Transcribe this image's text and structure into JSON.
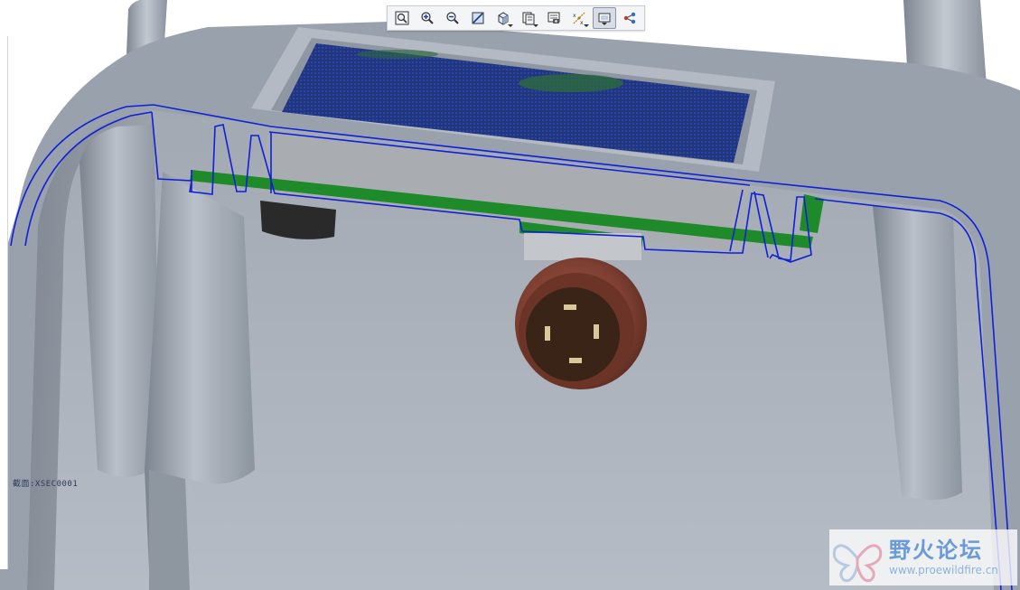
{
  "toolbar": {
    "buttons": [
      {
        "id": "refit",
        "icon": "zoom-fit-icon",
        "tooltip": "Refit"
      },
      {
        "id": "zoom-in",
        "icon": "zoom-in-icon",
        "tooltip": "Zoom In"
      },
      {
        "id": "zoom-out",
        "icon": "zoom-out-icon",
        "tooltip": "Zoom Out"
      },
      {
        "id": "repaint",
        "icon": "repaint-icon",
        "tooltip": "Repaint"
      },
      {
        "id": "display-style",
        "icon": "shaded-cube-icon",
        "tooltip": "Display Style"
      },
      {
        "id": "saved-views",
        "icon": "saved-views-icon",
        "tooltip": "Saved Orientations"
      },
      {
        "id": "view-manager",
        "icon": "view-manager-icon",
        "tooltip": "View Manager"
      },
      {
        "id": "datum-display",
        "icon": "datum-display-icon",
        "tooltip": "Datum Display Filters"
      },
      {
        "id": "section-view",
        "icon": "section-view-icon",
        "tooltip": "Section View",
        "active": true
      },
      {
        "id": "annotation",
        "icon": "network-icon",
        "tooltip": "Annotation Display"
      }
    ]
  },
  "viewport": {
    "section_label": "截面:XSEC0001",
    "colors": {
      "housing": "#9aa2ad",
      "housing_dark": "#7f8792",
      "interior": "#a8afb9",
      "section_outline": "#1020d8",
      "pcb": "#1f8a2a",
      "display": "#203a8a",
      "connector": "#8b4a3a",
      "connector_face": "#3a2418",
      "pin": "#d8c99a"
    }
  },
  "watermark": {
    "name": "野火论坛",
    "url": "www.proewildfire.cn"
  }
}
